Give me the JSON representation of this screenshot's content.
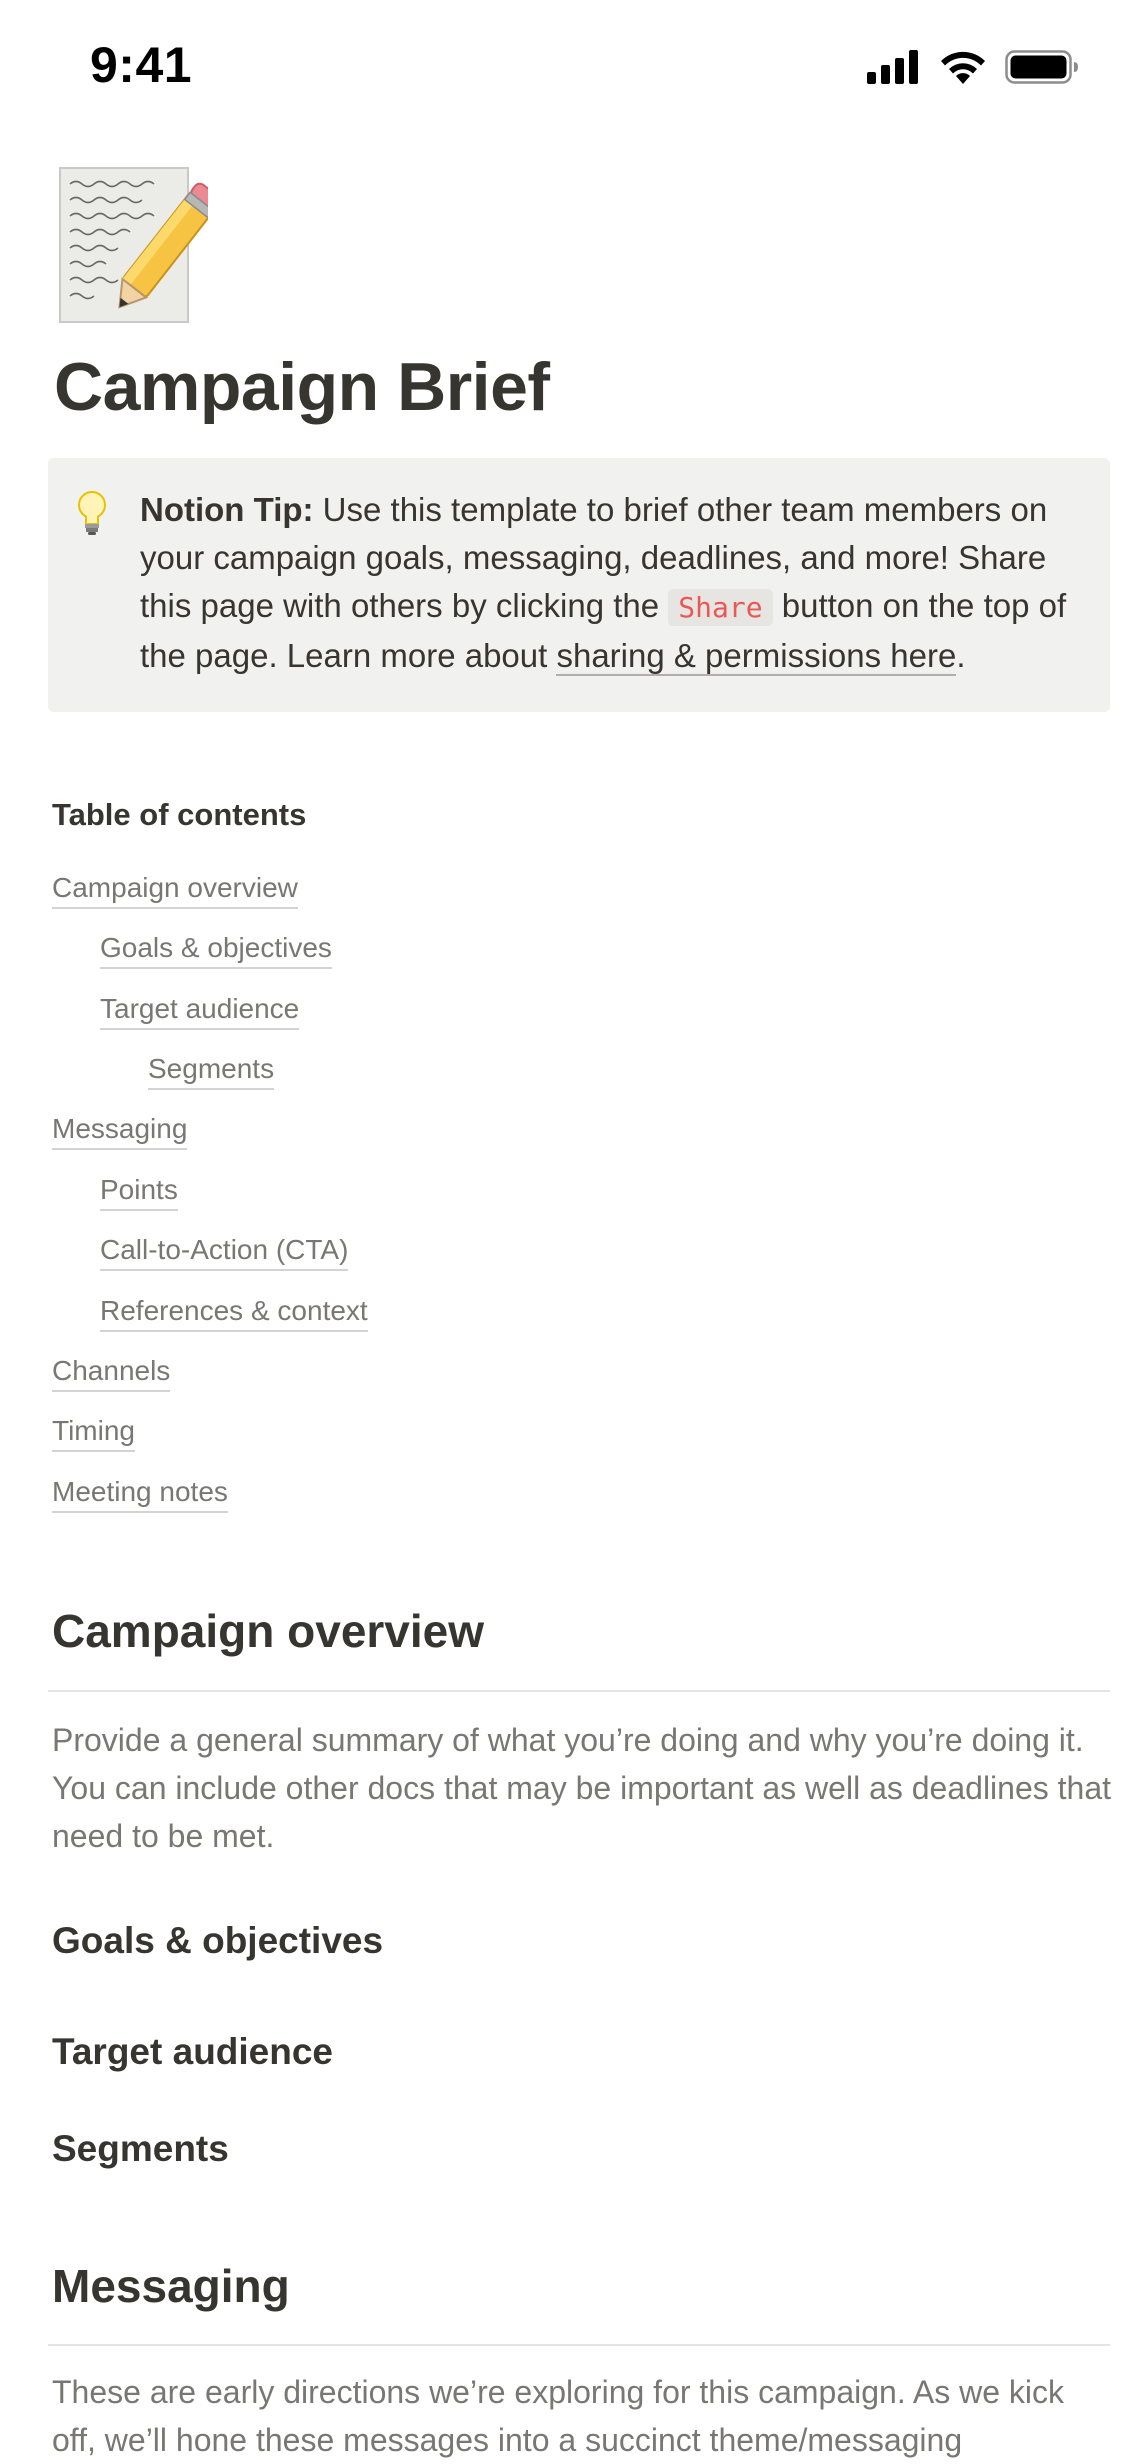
{
  "status_bar": {
    "time": "9:41"
  },
  "page": {
    "title": "Campaign Brief",
    "icon": "memo-pencil-icon"
  },
  "callout": {
    "icon": "light-bulb-icon",
    "bold": "Notion Tip:",
    "text_1": " Use this template to brief other team members on your campaign goals, messaging, deadlines, and more! Share this page with others by clicking the ",
    "code": "Share",
    "text_2": " button on the top of the page. Learn more about ",
    "link": "sharing & permissions here",
    "text_3": "."
  },
  "toc": {
    "title": "Table of contents",
    "items": [
      "Campaign overview",
      "Goals & objectives",
      "Target audience",
      "Segments",
      "Messaging",
      "Points",
      "Call-to-Action (CTA)",
      "References & context",
      "Channels",
      "Timing",
      "Meeting notes"
    ]
  },
  "sections": {
    "overview_heading": "Campaign overview",
    "overview_body": "Provide a general summary of what you’re doing and why you’re doing it. You can include other docs that may be important as well as deadlines that need to be met.",
    "goals_heading": "Goals & objectives",
    "audience_heading": "Target audience",
    "segments_heading": "Segments",
    "messaging_heading": "Messaging",
    "messaging_body": "These are early directions we’re exploring for this campaign. As we kick off, we’ll hone these messages into a succinct theme/messaging"
  }
}
